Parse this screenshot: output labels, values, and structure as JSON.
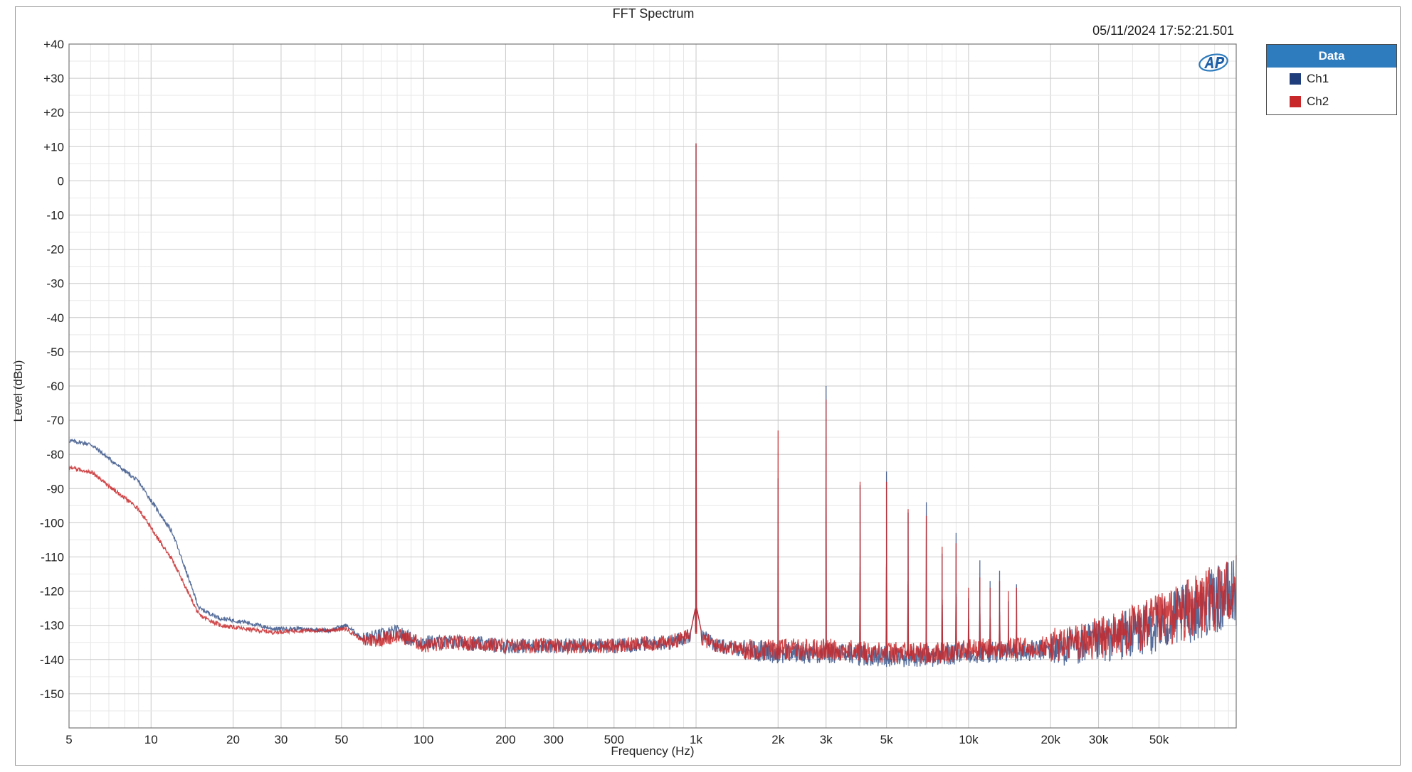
{
  "chart_data": {
    "type": "line",
    "title": "FFT Spectrum",
    "timestamp": "05/11/2024 17:52:21.501",
    "xlabel": "Frequency (Hz)",
    "ylabel": "Level (dBu)",
    "x_scale": "log",
    "xlim": [
      5,
      96000
    ],
    "ylim": [
      -160,
      40
    ],
    "grid": true,
    "legend": {
      "title": "Data",
      "placement": "right"
    },
    "x_ticks": [
      {
        "value": 5,
        "label": "5"
      },
      {
        "value": 10,
        "label": "10"
      },
      {
        "value": 20,
        "label": "20"
      },
      {
        "value": 30,
        "label": "30"
      },
      {
        "value": 50,
        "label": "50"
      },
      {
        "value": 100,
        "label": "100"
      },
      {
        "value": 200,
        "label": "200"
      },
      {
        "value": 300,
        "label": "300"
      },
      {
        "value": 500,
        "label": "500"
      },
      {
        "value": 1000,
        "label": "1k"
      },
      {
        "value": 2000,
        "label": "2k"
      },
      {
        "value": 3000,
        "label": "3k"
      },
      {
        "value": 5000,
        "label": "5k"
      },
      {
        "value": 10000,
        "label": "10k"
      },
      {
        "value": 20000,
        "label": "20k"
      },
      {
        "value": 30000,
        "label": "30k"
      },
      {
        "value": 50000,
        "label": "50k"
      }
    ],
    "y_ticks": [
      {
        "value": 40,
        "label": "+40"
      },
      {
        "value": 30,
        "label": "+30"
      },
      {
        "value": 20,
        "label": "+20"
      },
      {
        "value": 10,
        "label": "+10"
      },
      {
        "value": 0,
        "label": "0"
      },
      {
        "value": -10,
        "label": "-10"
      },
      {
        "value": -20,
        "label": "-20"
      },
      {
        "value": -30,
        "label": "-30"
      },
      {
        "value": -40,
        "label": "-40"
      },
      {
        "value": -50,
        "label": "-50"
      },
      {
        "value": -60,
        "label": "-60"
      },
      {
        "value": -70,
        "label": "-70"
      },
      {
        "value": -80,
        "label": "-80"
      },
      {
        "value": -90,
        "label": "-90"
      },
      {
        "value": -100,
        "label": "-100"
      },
      {
        "value": -110,
        "label": "-110"
      },
      {
        "value": -120,
        "label": "-120"
      },
      {
        "value": -130,
        "label": "-130"
      },
      {
        "value": -140,
        "label": "-140"
      },
      {
        "value": -150,
        "label": "-150"
      }
    ],
    "series": [
      {
        "name": "Ch1",
        "color": "#1f3d7a",
        "noise_floor": [
          [
            5,
            -76
          ],
          [
            6,
            -77
          ],
          [
            9,
            -88
          ],
          [
            12,
            -103
          ],
          [
            15,
            -125
          ],
          [
            18,
            -128
          ],
          [
            22,
            -129
          ],
          [
            28,
            -131
          ],
          [
            35,
            -131
          ],
          [
            45,
            -131.5
          ],
          [
            52,
            -130
          ],
          [
            60,
            -134
          ],
          [
            70,
            -133
          ],
          [
            80,
            -132
          ],
          [
            90,
            -134
          ],
          [
            100,
            -135
          ],
          [
            130,
            -135
          ],
          [
            200,
            -136
          ],
          [
            300,
            -136
          ],
          [
            500,
            -136
          ],
          [
            800,
            -135
          ],
          [
            950,
            -133
          ],
          [
            1050,
            -133
          ],
          [
            1200,
            -136
          ],
          [
            1500,
            -137
          ],
          [
            2000,
            -138
          ],
          [
            3000,
            -138
          ],
          [
            5000,
            -139
          ],
          [
            8000,
            -139
          ],
          [
            10000,
            -138
          ],
          [
            14000,
            -138
          ],
          [
            20000,
            -137
          ],
          [
            30000,
            -135
          ],
          [
            50000,
            -130
          ],
          [
            70000,
            -125
          ],
          [
            96000,
            -120
          ]
        ],
        "peaks": [
          [
            1000,
            10.8
          ],
          [
            2000,
            -87
          ],
          [
            3000,
            -60
          ],
          [
            4000,
            -89
          ],
          [
            5000,
            -85
          ],
          [
            6000,
            -97
          ],
          [
            7000,
            -94
          ],
          [
            8000,
            -109
          ],
          [
            9000,
            -103
          ],
          [
            10000,
            -122
          ],
          [
            11000,
            -111
          ],
          [
            12000,
            -117
          ],
          [
            13000,
            -114
          ],
          [
            14000,
            -123
          ],
          [
            15000,
            -118
          ]
        ]
      },
      {
        "name": "Ch2",
        "color": "#c8282a",
        "noise_floor": [
          [
            5,
            -84
          ],
          [
            6,
            -85
          ],
          [
            9,
            -96
          ],
          [
            12,
            -111
          ],
          [
            15,
            -127
          ],
          [
            18,
            -130
          ],
          [
            22,
            -131
          ],
          [
            28,
            -132
          ],
          [
            35,
            -131.5
          ],
          [
            45,
            -131.5
          ],
          [
            52,
            -131
          ],
          [
            60,
            -134.5
          ],
          [
            70,
            -134
          ],
          [
            80,
            -133
          ],
          [
            90,
            -134
          ],
          [
            100,
            -136
          ],
          [
            130,
            -135
          ],
          [
            200,
            -136
          ],
          [
            300,
            -136
          ],
          [
            500,
            -136
          ],
          [
            800,
            -135
          ],
          [
            950,
            -133
          ],
          [
            1050,
            -134
          ],
          [
            1200,
            -136
          ],
          [
            1500,
            -137
          ],
          [
            2000,
            -137
          ],
          [
            3000,
            -137
          ],
          [
            5000,
            -138
          ],
          [
            8000,
            -138
          ],
          [
            10000,
            -137
          ],
          [
            14000,
            -137
          ],
          [
            20000,
            -136
          ],
          [
            30000,
            -134
          ],
          [
            50000,
            -129
          ],
          [
            70000,
            -124
          ],
          [
            96000,
            -119
          ]
        ],
        "peaks": [
          [
            1000,
            11.0
          ],
          [
            2000,
            -73
          ],
          [
            3000,
            -64
          ],
          [
            4000,
            -88
          ],
          [
            5000,
            -88
          ],
          [
            6000,
            -96
          ],
          [
            7000,
            -98
          ],
          [
            8000,
            -107
          ],
          [
            9000,
            -106
          ],
          [
            10000,
            -119
          ],
          [
            11000,
            -116
          ],
          [
            12000,
            -119
          ],
          [
            13000,
            -117
          ],
          [
            14000,
            -120
          ],
          [
            15000,
            -119
          ]
        ]
      }
    ]
  },
  "legend_items": [
    {
      "label": "Ch1",
      "color": "#1f3d7a"
    },
    {
      "label": "Ch2",
      "color": "#c8282a"
    }
  ]
}
